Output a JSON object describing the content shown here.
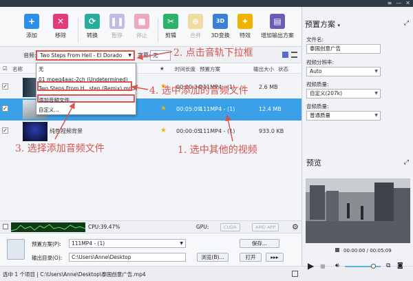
{
  "window": {
    "controls": [
      "≡",
      "—",
      "✕"
    ]
  },
  "toolbar": {
    "buttons": [
      {
        "label": "添加",
        "icon": "add-icon",
        "color": "#2d8ee8",
        "enabled": true
      },
      {
        "label": "移除",
        "icon": "remove-icon",
        "color": "#e23a7a",
        "enabled": true
      },
      {
        "label": "转换",
        "icon": "convert-icon",
        "color": "#27ae9b",
        "enabled": true
      },
      {
        "label": "暂停",
        "icon": "pause-icon",
        "color": "#8a7fd1",
        "enabled": false
      },
      {
        "label": "停止",
        "icon": "stop-icon",
        "color": "#e25a8a",
        "enabled": false
      },
      {
        "label": "剪辑",
        "icon": "clip-icon",
        "color": "#2bb36a",
        "enabled": true
      },
      {
        "label": "合并",
        "icon": "merge-icon",
        "color": "#e8c24a",
        "enabled": false
      },
      {
        "label": "3D变换",
        "icon": "3d-icon",
        "color": "#3a7fd6",
        "enabled": true
      },
      {
        "label": "特效",
        "icon": "effects-icon",
        "color": "#f0b400",
        "enabled": true
      },
      {
        "label": "增加输出方案",
        "icon": "add-profile-icon",
        "color": "#6a5bb8",
        "enabled": true
      }
    ]
  },
  "audio_track": {
    "label": "音频:",
    "selected": "Two Steps From Hell - El Dorado",
    "subtitle_label": "字幕:",
    "subtitle_value": "无"
  },
  "list_header": {
    "name": "名称",
    "star": "★",
    "duration": "时间长度",
    "profile": "预置方案",
    "size": "输出大小",
    "status": "状态"
  },
  "files": [
    {
      "checked": true,
      "name": "",
      "duration": "00:00:34",
      "profile": "111MP4 - (1)",
      "size": "2.6 MB",
      "selected": false
    },
    {
      "checked": true,
      "name": "",
      "duration": "00:05:09",
      "profile": "111MP4 - (1)",
      "size": "12.4 MB",
      "selected": true
    },
    {
      "checked": true,
      "name": "纯色视频背景",
      "duration": "00:00:05",
      "profile": "111MP4 - (1)",
      "size": "933.0 KB",
      "selected": false
    }
  ],
  "dropdown": {
    "items": [
      "无",
      "01 mpeg4aac-2ch (Undetermined)",
      "Two Steps From H...step (Remix).mp3",
      "添加音频文件...",
      "自定义..."
    ],
    "highlighted_index": 3
  },
  "annotations": {
    "step1": "1. 选中其他的视频",
    "step2": "2. 点击音轨下拉框",
    "step3": "3. 选择添加音频文件",
    "step4": "4. 选中添加的音频文件",
    "color": "#d9534f"
  },
  "cpu": {
    "label": "CPU:39.47%",
    "gpu_label": "GPU:",
    "cuda": "CUDA",
    "amd": "AMD APP"
  },
  "output": {
    "profile_label": "预置方案(P):",
    "profile_value": "111MP4 - (1)",
    "save_button": "保存...",
    "dir_label": "输出目录(O):",
    "dir_value": "C:\\Users\\Anne\\Desktop",
    "browse_button": "浏览(B)...",
    "open_button": "打开",
    "more_button": "▸▸▸"
  },
  "status": {
    "text": "选中 1 个项目 | C:\\Users\\Anne\\Desktop\\泰国创意广告.mp4"
  },
  "right_panel": {
    "title": "预置方案",
    "filename_label": "文件名:",
    "filename_value": "泰国创意广告",
    "resolution_label": "视频分辨率:",
    "resolution_value": "Auto",
    "video_quality_label": "视频质量:",
    "video_quality_value": "自定义(207k)",
    "audio_quality_label": "音频质量:",
    "audio_quality_value": "普通质量",
    "preview_title": "预览",
    "time": "00:00:00 / 00:05:09"
  }
}
